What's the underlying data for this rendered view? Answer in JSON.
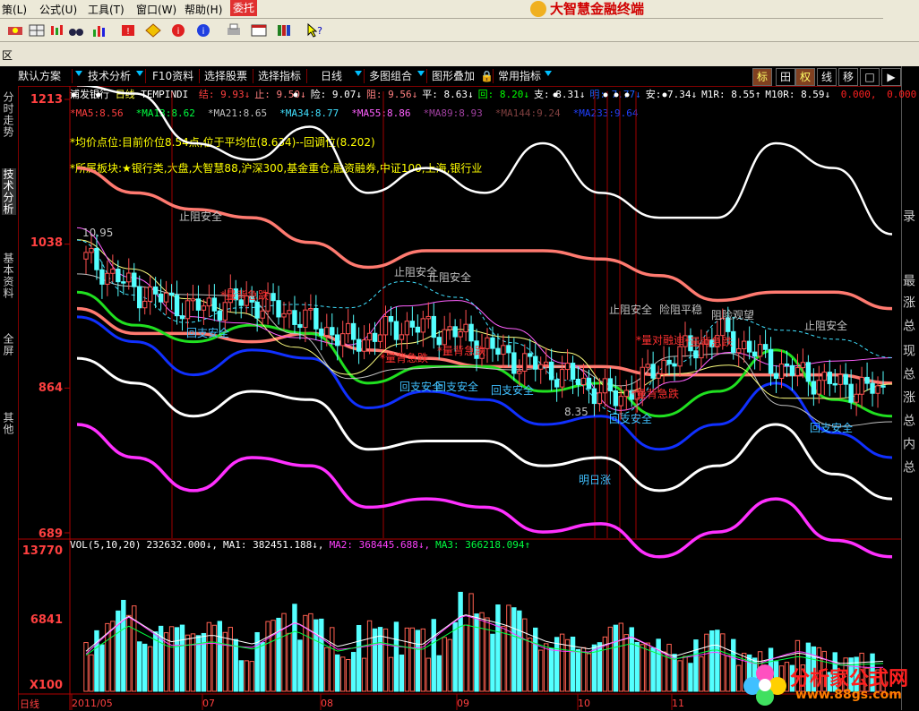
{
  "menu": {
    "items": [
      "策(L)",
      "公式(U)",
      "工具(T)",
      "窗口(W)",
      "帮助(H)",
      "委托"
    ],
    "brand": "大智慧金融终端"
  },
  "zone": {
    "label": "区"
  },
  "tabs": {
    "left": [
      "默认方案",
      "技术分析",
      "F10资料",
      "选择股票",
      "选择指标",
      "日线",
      "多图组合",
      "图形叠加",
      "常用指标"
    ],
    "right": [
      "标",
      "田",
      "权",
      "线",
      "移",
      "□",
      "▶"
    ]
  },
  "vtabs": [
    "分时走势",
    "技术分析",
    "基本资料",
    "全屏",
    "其他"
  ],
  "right_panel_chars": [
    "录",
    "最",
    "涨",
    "总",
    "现",
    "总",
    "涨",
    "总",
    "内",
    "总"
  ],
  "stock": {
    "name": "浦发银行",
    "period": "日线",
    "indicator": "TEMPINDI",
    "readout": [
      {
        "k": "结:",
        "v": "9.93↓",
        "c": "#ff4040"
      },
      {
        "k": "止:",
        "v": "9.50↓",
        "c": "#ff8080"
      },
      {
        "k": "险:",
        "v": "9.07↓",
        "c": "#ffffff"
      },
      {
        "k": "阻:",
        "v": "9.56↓",
        "c": "#ff8080"
      },
      {
        "k": "平:",
        "v": "8.63↓",
        "c": "#ffffff"
      },
      {
        "k": "回:",
        "v": "8.20↓",
        "c": "#00ff00"
      },
      {
        "k": "支:",
        "v": "8.31↓",
        "c": "#ffffff"
      },
      {
        "k": "明:",
        "v": "7.77↓",
        "c": "#2060ff"
      },
      {
        "k": "安:",
        "v": "7.34↓",
        "c": "#ffffff"
      },
      {
        "k": "M1R:",
        "v": "8.55↑",
        "c": "#ffffff"
      },
      {
        "k": "M10R:",
        "v": "8.59↓",
        "c": "#ffffff"
      },
      {
        "k": "",
        "v": "0.000,",
        "c": "#ff2020"
      },
      {
        "k": "",
        "v": "0.000",
        "c": "#ff2020"
      }
    ],
    "ma": [
      {
        "label": "MA5:",
        "value": "8.56",
        "color": "#ff4040"
      },
      {
        "label": "MA13:",
        "value": "8.62",
        "color": "#00ff40"
      },
      {
        "label": "MA21:",
        "value": "8.65",
        "color": "#c0c0c0"
      },
      {
        "label": "MA34:",
        "value": "8.77",
        "color": "#40e0ff"
      },
      {
        "label": "MA55:",
        "value": "8.86",
        "color": "#ff60ff"
      },
      {
        "label": "MA89:",
        "value": "8.93",
        "color": "#a040a0"
      },
      {
        "label": "MA144:",
        "value": "9.24",
        "color": "#804040"
      },
      {
        "label": "MA233:",
        "value": "9.64",
        "color": "#2040ff"
      }
    ],
    "notes": [
      "*均价点位:目前价位8.54点,位于平均位(8.634)--回调位(8.202)",
      "*所属板块:★银行类,大盘,大智慧88,沪深300,基金重仓,融资融券,中证100,上海,银行业"
    ]
  },
  "price_axis": {
    "labels": [
      "1213",
      "1038",
      "864",
      "689"
    ]
  },
  "volume": {
    "header": [
      {
        "t": "VOL(5,10,20)",
        "c": "#ffffff"
      },
      {
        "t": "232632.000↓,",
        "c": "#ffffff"
      },
      {
        "t": "MA1: 382451.188↓,",
        "c": "#ffffff"
      },
      {
        "t": "MA2: 368445.688↓,",
        "c": "#ff40ff"
      },
      {
        "t": "MA3: 366218.094↑",
        "c": "#00ff40"
      }
    ],
    "axis": [
      "13770",
      "6841",
      "X100"
    ]
  },
  "xaxis": {
    "labels": [
      "2011/05",
      "07",
      "08",
      "09",
      "10",
      "11"
    ],
    "period_btn": "日线"
  },
  "chart_labels": [
    {
      "t": "止阻安全",
      "c": "#c0c0c0"
    },
    {
      "t": "止阻安全",
      "c": "#c0c0c0"
    },
    {
      "t": "止阻安全",
      "c": "#c0c0c0"
    },
    {
      "t": "止阻安全",
      "c": "#c0c0c0"
    },
    {
      "t": "止阻安全",
      "c": "#c0c0c0"
    },
    {
      "t": "险阻平稳",
      "c": "#c0c0c0"
    },
    {
      "t": "阻险观望",
      "c": "#c0c0c0"
    },
    {
      "t": "回支安全",
      "c": "#40c0ff"
    },
    {
      "t": "回支安全",
      "c": "#40c0ff"
    },
    {
      "t": "回支安全",
      "c": "#40c0ff"
    },
    {
      "t": "回支安全",
      "c": "#40c0ff"
    },
    {
      "t": "回支安全",
      "c": "#40c0ff"
    },
    {
      "t": "回支安全",
      "c": "#40c0ff"
    },
    {
      "t": "明日涨",
      "c": "#40c0ff"
    },
    {
      "t": "*量背急跌",
      "c": "#ff3030"
    },
    {
      "t": "*量背急跌",
      "c": "#ff3030"
    },
    {
      "t": "*量背急跌",
      "c": "#ff3030"
    },
    {
      "t": "*量背急跌",
      "c": "#ff3030"
    },
    {
      "t": "*量背急跌",
      "c": "#ff3030"
    },
    {
      "t": "*量对融迪",
      "c": "#ff3030"
    },
    {
      "t": "10.95",
      "c": "#c0c0c0"
    },
    {
      "t": "8.35",
      "c": "#c0c0c0"
    }
  ],
  "watermark": {
    "line1": "分析家公式网",
    "line2": "www.88gs.com"
  },
  "colors": {
    "up": "#ff5050",
    "down": "#54ffff",
    "band_white": "#ffffff",
    "band_salmon": "#ff7a70",
    "band_green": "#20e020",
    "band_blue": "#1030ff",
    "band_magenta": "#ff30ff"
  },
  "chart_data": {
    "type": "candlestick",
    "x_labels": [
      "2011/05",
      "07",
      "08",
      "09",
      "10",
      "11"
    ],
    "y_ticks": [
      12.13,
      10.38,
      8.64,
      6.89
    ],
    "bands": [
      {
        "name": "white-top",
        "color": "#ffffff",
        "values": [
          12.3,
          12.2,
          11.6,
          11.4,
          11.8,
          11.0,
          11.3,
          11.0,
          11.6,
          11.0,
          10.7,
          10.7,
          11.6,
          11.3,
          10.5
        ]
      },
      {
        "name": "salmon-top",
        "color": "#ff7a70",
        "values": [
          11.3,
          11.0,
          10.8,
          10.7,
          10.4,
          10.1,
          10.3,
          10.3,
          10.3,
          10.2,
          10.0,
          9.7,
          9.8,
          9.8,
          9.6
        ]
      },
      {
        "name": "salmon-mid",
        "color": "#ff7a70",
        "values": [
          9.6,
          9.3,
          9.3,
          9.2,
          9.3,
          9.1,
          9.0,
          8.9,
          8.9,
          8.9,
          8.8,
          8.8,
          8.8,
          8.8,
          8.7
        ]
      },
      {
        "name": "green",
        "color": "#20e020",
        "values": [
          9.8,
          9.4,
          9.2,
          9.4,
          9.3,
          8.7,
          8.9,
          8.9,
          8.6,
          8.7,
          8.3,
          8.6,
          9.1,
          8.5,
          8.3
        ]
      },
      {
        "name": "blue",
        "color": "#1030ff",
        "values": [
          9.5,
          9.2,
          8.8,
          9.1,
          9.0,
          8.4,
          8.6,
          8.5,
          8.2,
          8.3,
          7.9,
          8.2,
          8.7,
          8.1,
          7.8
        ]
      },
      {
        "name": "white-low",
        "color": "#ffffff",
        "values": [
          9.0,
          8.7,
          8.3,
          8.6,
          8.5,
          7.9,
          8.0,
          8.0,
          7.7,
          7.8,
          7.4,
          7.7,
          8.2,
          7.6,
          7.3
        ]
      },
      {
        "name": "magenta",
        "color": "#ff30ff",
        "values": [
          8.2,
          7.8,
          7.4,
          7.8,
          7.7,
          7.2,
          7.3,
          7.2,
          6.9,
          7.0,
          6.6,
          6.9,
          7.3,
          6.8,
          6.6
        ]
      }
    ],
    "closes": [
      10.2,
      9.8,
      9.6,
      9.7,
      9.5,
      9.2,
      9.4,
      9.3,
      9.0,
      8.8,
      8.5,
      9.0,
      9.3,
      8.9,
      8.7,
      8.6
    ],
    "volume_ylim": [
      0,
      13770
    ],
    "volume": [
      5200,
      9800,
      6400,
      7300,
      6100,
      9000,
      5800,
      7200,
      6000,
      10000,
      8600,
      6400,
      5500,
      7000,
      4500,
      6100,
      3800,
      5000,
      3600,
      3900
    ]
  }
}
